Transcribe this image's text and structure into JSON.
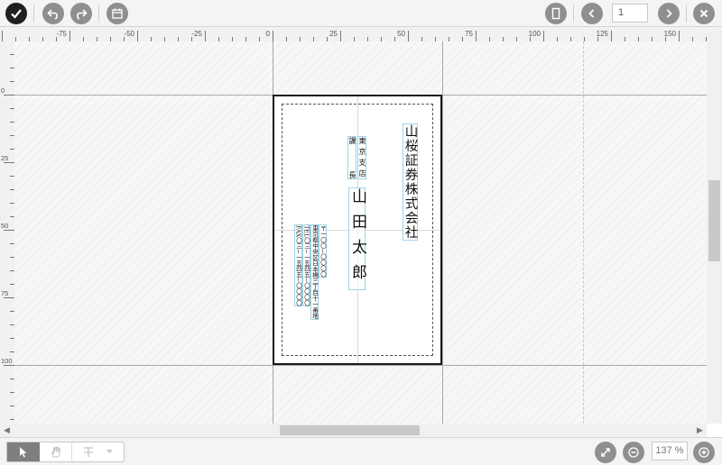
{
  "toolbar": {
    "confirm_icon": "check-icon",
    "undo_icon": "undo-icon",
    "redo_icon": "redo-icon",
    "calendar_icon": "calendar-icon",
    "orientation_icon": "page-orientation-icon",
    "prev_icon": "chevron-left-icon",
    "next_icon": "chevron-right-icon",
    "close_icon": "close-icon",
    "page_number": "1"
  },
  "ruler": {
    "top_labels": [
      "-75",
      "-50",
      "-25",
      "0",
      "25",
      "50",
      "75",
      "100",
      "125",
      "150"
    ],
    "left_labels": [
      "0",
      "25",
      "50",
      "75",
      "100"
    ]
  },
  "card": {
    "company": "山桜証券株式会社",
    "branch": "東京支店",
    "title": "課長",
    "name": "山田太郎",
    "address_postal": "〒一〇〇−〇〇〇〇",
    "address_line": "東京都中央区日本橋三丁目十一番地",
    "tel": "TEL〇三−一五四五−〇〇〇〇",
    "fax": "FAX〇三−一五四五−〇〇〇〇"
  },
  "bottom": {
    "select_tool_icon": "pointer-icon",
    "hand_tool_icon": "hand-icon",
    "text_tool_icon": "text-tool-icon",
    "fit_icon": "fit-to-window-icon",
    "zoom_out_icon": "zoom-out-icon",
    "zoom_in_icon": "zoom-in-icon",
    "zoom_level": "137 %"
  }
}
